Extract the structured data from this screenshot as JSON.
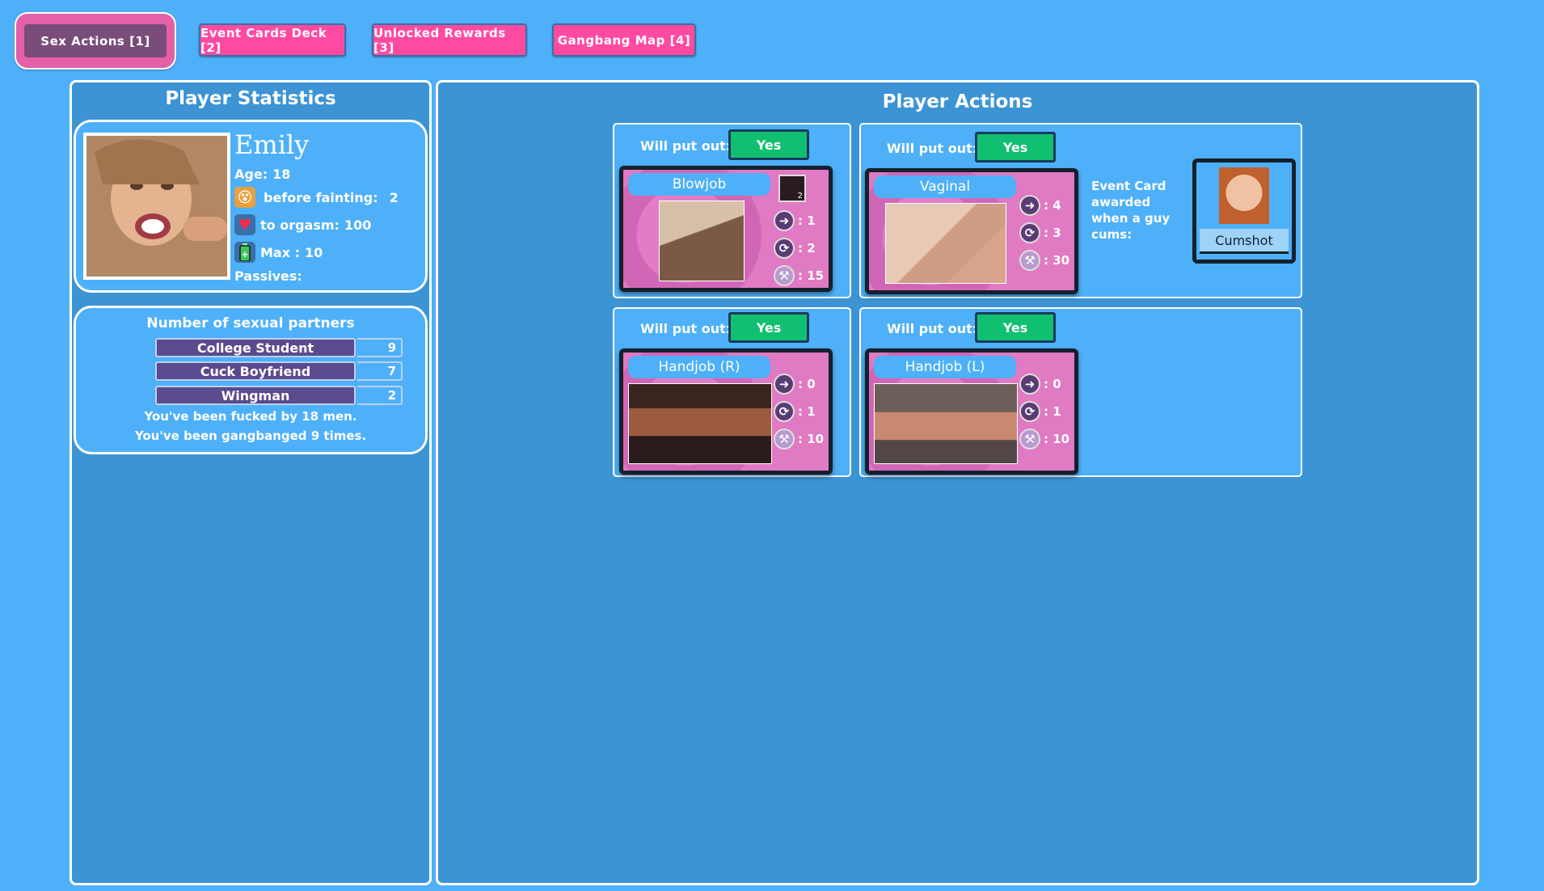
{
  "tabs": [
    {
      "label": "Sex Actions [1]"
    },
    {
      "label": "Event Cards Deck [2]"
    },
    {
      "label": "Unlocked Rewards [3]"
    },
    {
      "label": "Gangbang Map [4]"
    }
  ],
  "stats_panel": {
    "title": "Player Statistics",
    "name": "Emily",
    "age_label": "Age:",
    "age": "18",
    "fainting_label": "before fainting:",
    "fainting": "2",
    "orgasm_label": "to orgasm:",
    "orgasm": "100",
    "max_label": "Max :",
    "max": "10",
    "passives_label": "Passives:"
  },
  "partners": {
    "title": "Number of sexual partners",
    "rows": [
      {
        "name": "College Student",
        "count": "9"
      },
      {
        "name": "Cuck Boyfriend",
        "count": "7"
      },
      {
        "name": "Wingman",
        "count": "2"
      }
    ],
    "fucked_pre": "You've been fucked by",
    "fucked_num": "18",
    "fucked_post": "men.",
    "gangbang_pre": "You've been gangbanged",
    "gangbang_num": "9",
    "gangbang_post": "times."
  },
  "actions_panel": {
    "title": "Player Actions",
    "will_put_out": "Will put out:",
    "yes": "Yes",
    "cards": [
      {
        "label": "Blowjob",
        "move": ": 1",
        "cycle": ": 2",
        "tool": ": 15",
        "badge": "2"
      },
      {
        "label": "Vaginal",
        "move": ": 4",
        "cycle": ": 3",
        "tool": ": 30"
      },
      {
        "label": "Handjob (R)",
        "move": ": 0",
        "cycle": ": 1",
        "tool": ": 10"
      },
      {
        "label": "Handjob (L)",
        "move": ": 0",
        "cycle": ": 1",
        "tool": ": 10"
      }
    ],
    "event_card_title": "Event Card",
    "event_card_desc_1": "awarded",
    "event_card_desc_2": "when a guy",
    "event_card_desc_3": "cums:",
    "event_card_label": "Cumshot"
  },
  "icons": {
    "fainting": "dizzy-face-icon",
    "orgasm": "heart-icon",
    "max": "battery-icon",
    "move": "arrow-right-icon",
    "cycle": "cycle-icon",
    "tool": "tool-icon"
  }
}
